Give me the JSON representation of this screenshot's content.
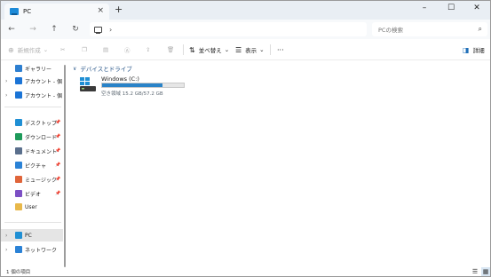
{
  "tab": {
    "title": "PC",
    "close": "×"
  },
  "titlebar": {
    "new_tab": "+",
    "minimize": "–",
    "maximize": "☐",
    "close": "✕"
  },
  "nav": {
    "back": "←",
    "forward": "→",
    "up": "↑",
    "refresh": "↻",
    "path_chevron": "›"
  },
  "search": {
    "placeholder": "PCの検索"
  },
  "commands": {
    "new": "新規作成",
    "sort": "並べ替え",
    "view": "表示",
    "more": "···",
    "details": "詳細"
  },
  "sidebar": {
    "items": [
      {
        "label": "ギャラリー",
        "expandable": false,
        "pinned": false,
        "icon_color": "#2d7fd0"
      },
      {
        "label": "アカウント - 個人用",
        "expandable": true,
        "pinned": false,
        "icon_color": "#1b74d6"
      },
      {
        "label": "アカウント - 個人用",
        "expandable": true,
        "pinned": false,
        "icon_color": "#1b74d6"
      },
      {
        "label": "デスクトップ",
        "expandable": false,
        "pinned": true,
        "icon_color": "#1f8fd4"
      },
      {
        "label": "ダウンロード",
        "expandable": false,
        "pinned": true,
        "icon_color": "#1e9a5a"
      },
      {
        "label": "ドキュメント",
        "expandable": false,
        "pinned": true,
        "icon_color": "#5a6f8c"
      },
      {
        "label": "ピクチャ",
        "expandable": false,
        "pinned": true,
        "icon_color": "#2b82d6"
      },
      {
        "label": "ミュージック",
        "expandable": false,
        "pinned": true,
        "icon_color": "#e0653a"
      },
      {
        "label": "ビデオ",
        "expandable": false,
        "pinned": true,
        "icon_color": "#7c4fc4"
      },
      {
        "label": "User",
        "expandable": false,
        "pinned": false,
        "icon_color": "#e8b84a"
      },
      {
        "label": "PC",
        "expandable": true,
        "pinned": false,
        "icon_color": "#1f8fd4",
        "selected": true
      },
      {
        "label": "ネットワーク",
        "expandable": true,
        "pinned": false,
        "icon_color": "#2b82d6"
      }
    ],
    "pin_glyph": "📌",
    "expand_glyph": "›"
  },
  "main": {
    "group_title": "デバイスとドライブ",
    "group_chevron": "∨",
    "drive": {
      "name": "Windows (C:)",
      "space_text": "空き領域 15.2 GB/57.2 GB",
      "used_fraction": 0.734
    }
  },
  "status": {
    "text": "1 個の項目"
  },
  "colors": {
    "accent": "#2a83c8",
    "header_text": "#1f4f84"
  }
}
